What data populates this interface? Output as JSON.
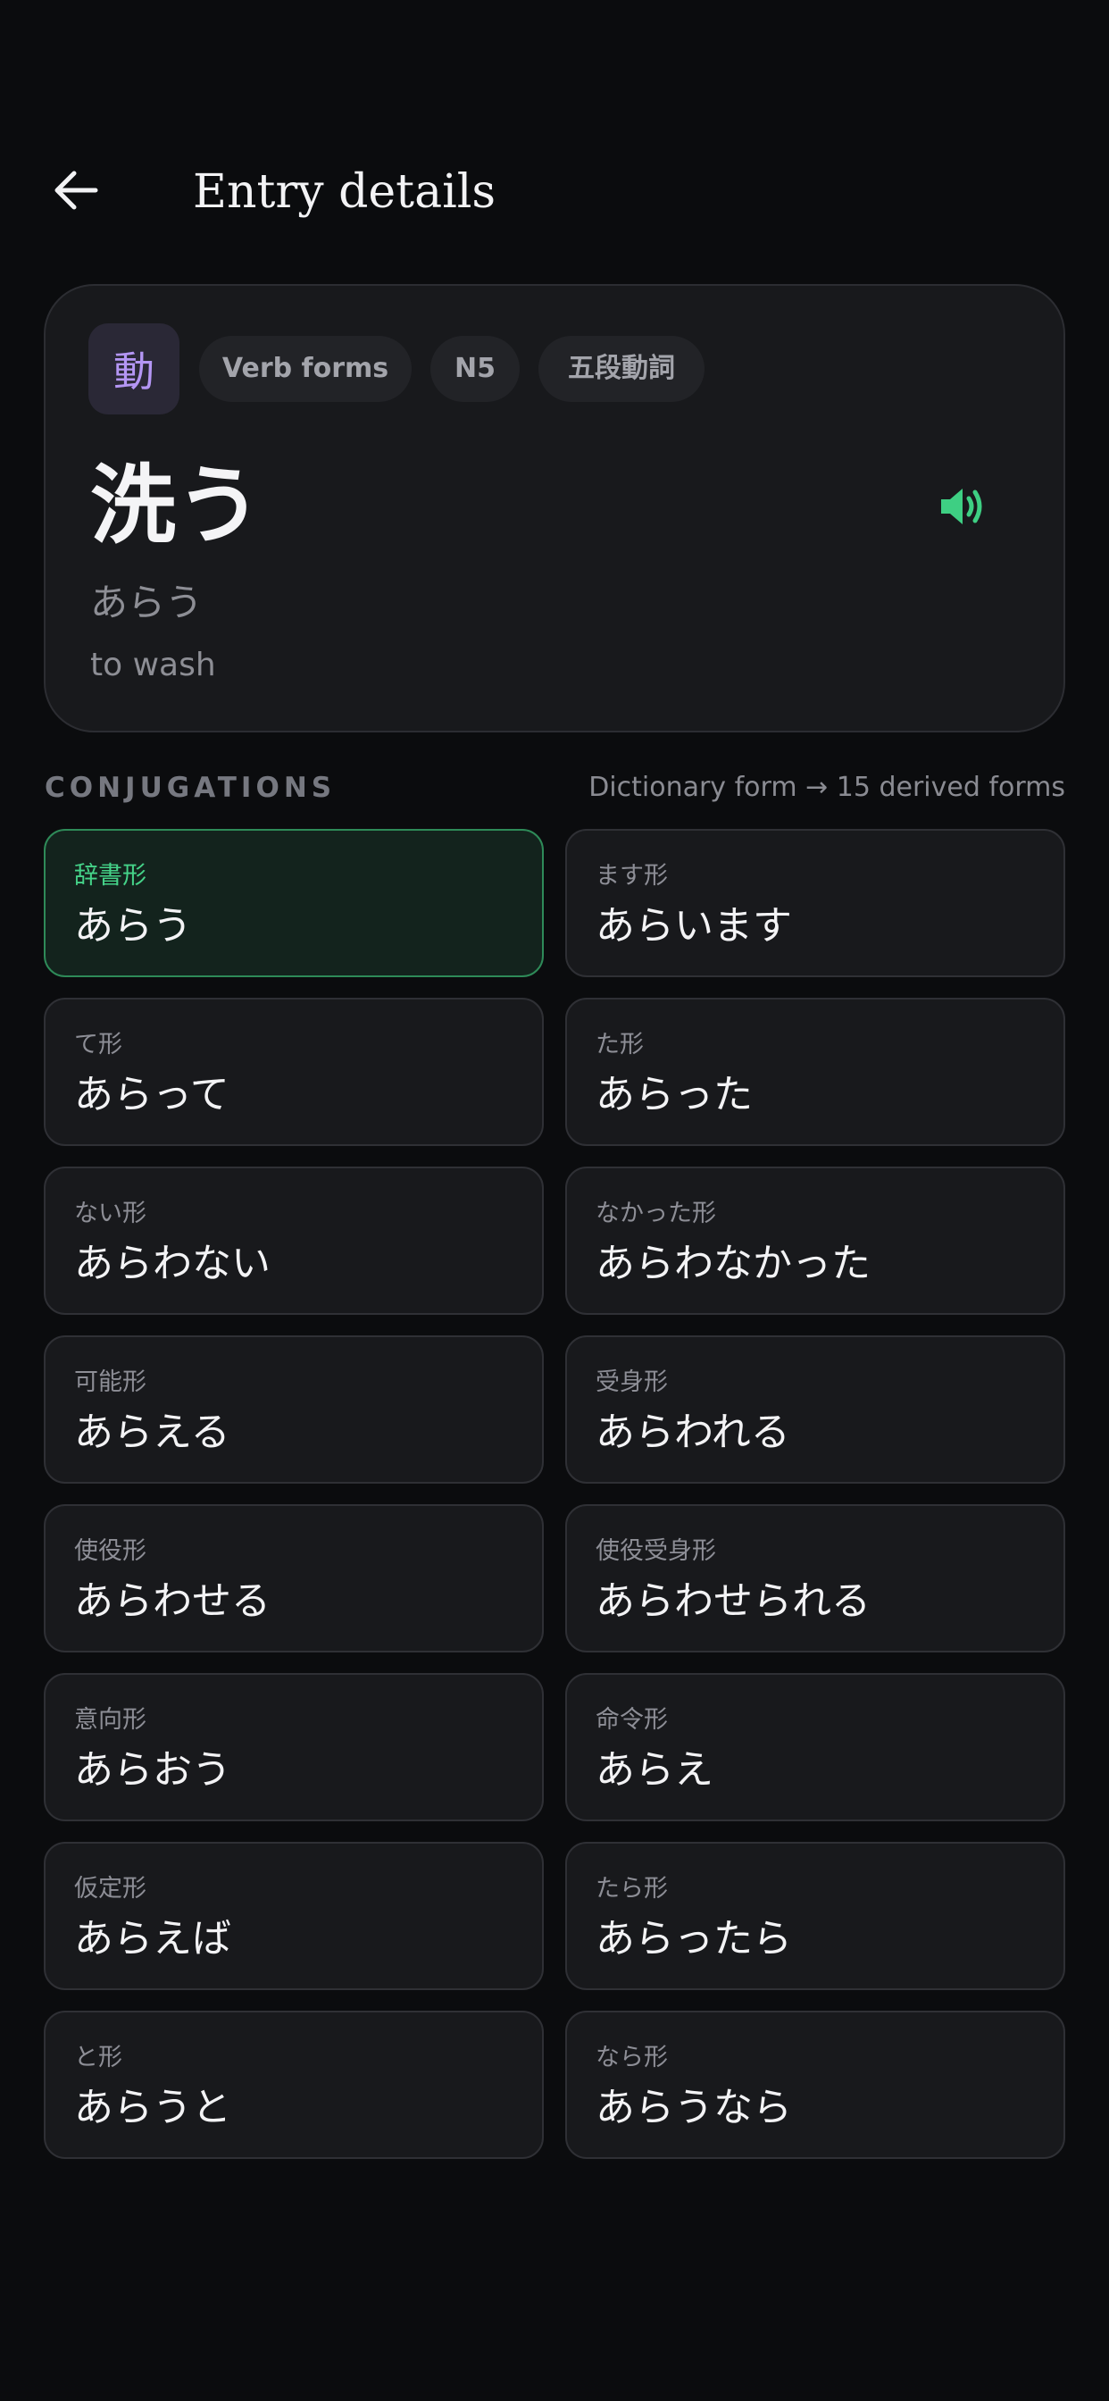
{
  "header": {
    "title": "Entry details",
    "back_icon": "arrow-left-icon"
  },
  "entry": {
    "kanji_badge": "動",
    "tags": [
      "Verb forms",
      "N5",
      "五段動詞"
    ],
    "word": "洗う",
    "reading": "あらう",
    "meaning": "to wash",
    "sound_icon": "speaker-icon",
    "accent_color": "#3ecf83",
    "badge_color": "#b496f4"
  },
  "conjugations": {
    "title": "CONJUGATIONS",
    "note": "Dictionary form → 15 derived forms",
    "forms": [
      {
        "label": "辞書形",
        "value": "あらう",
        "active": true
      },
      {
        "label": "ます形",
        "value": "あらいます"
      },
      {
        "label": "て形",
        "value": "あらって"
      },
      {
        "label": "た形",
        "value": "あらった"
      },
      {
        "label": "ない形",
        "value": "あらわない"
      },
      {
        "label": "なかった形",
        "value": "あらわなかった"
      },
      {
        "label": "可能形",
        "value": "あらえる"
      },
      {
        "label": "受身形",
        "value": "あらわれる"
      },
      {
        "label": "使役形",
        "value": "あらわせる"
      },
      {
        "label": "使役受身形",
        "value": "あらわせられる"
      },
      {
        "label": "意向形",
        "value": "あらおう"
      },
      {
        "label": "命令形",
        "value": "あらえ"
      },
      {
        "label": "仮定形",
        "value": "あらえば"
      },
      {
        "label": "たら形",
        "value": "あらったら"
      },
      {
        "label": "と形",
        "value": "あらうと"
      },
      {
        "label": "なら形",
        "value": "あらうなら"
      }
    ]
  }
}
